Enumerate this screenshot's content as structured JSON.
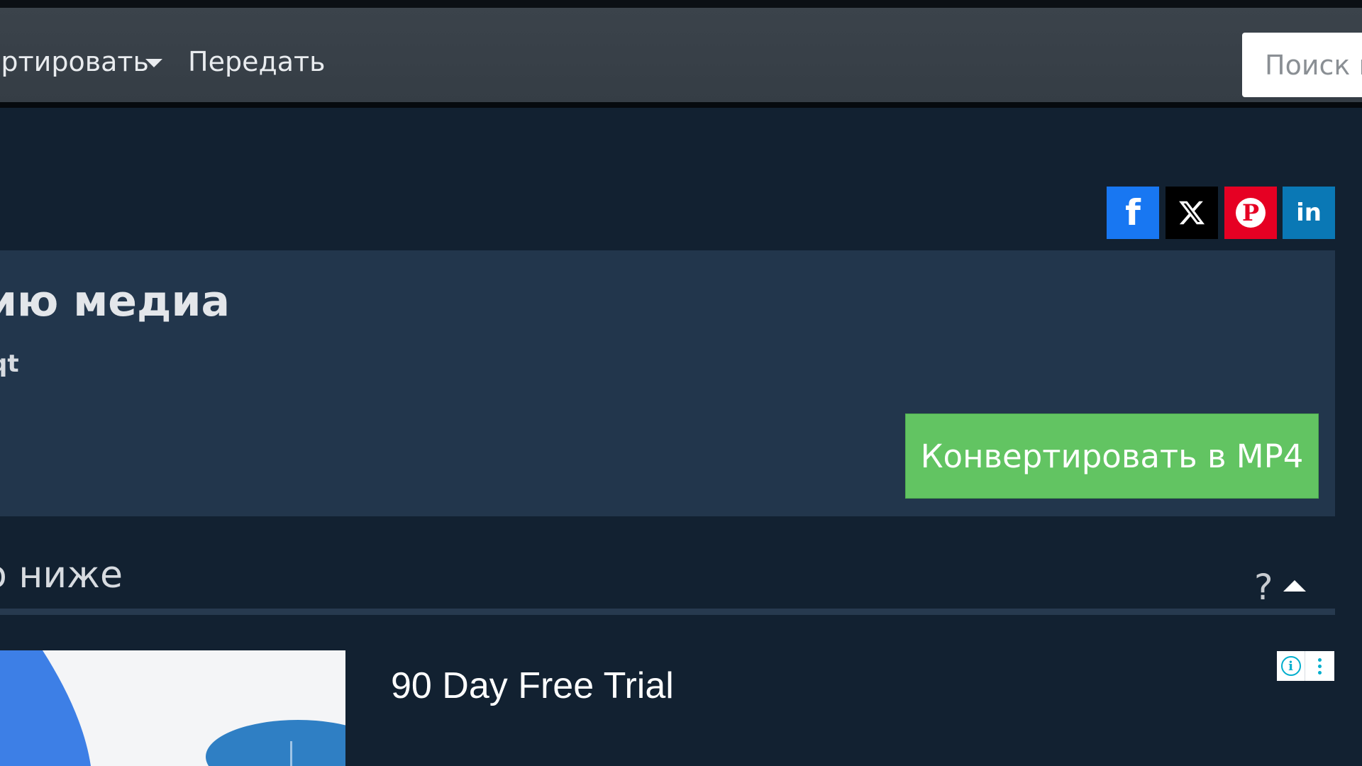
{
  "navbar": {
    "convert_menu_label": "ертировать",
    "transfer_label": "Передать",
    "search_placeholder": "Поиск в"
  },
  "share_buttons": {
    "facebook_glyph": "f",
    "pinterest_glyph": "P",
    "linkedin_glyph": "in",
    "colors": {
      "facebook": "#1877f2",
      "x": "#000000",
      "pinterest": "#e60023",
      "linkedin": "#0a78b5"
    }
  },
  "panel": {
    "title": "ию медиа",
    "subtitle": "qt",
    "convert_button_label": "Конвертировать в MP4"
  },
  "section": {
    "label": "о ниже",
    "help_glyph": "?"
  },
  "ad": {
    "title": "90 Day Free Trial",
    "info_glyph": "i"
  },
  "colors": {
    "background": "#122131",
    "navbar": "#383f47",
    "panel": "#22364c",
    "accent_green": "#62c462"
  }
}
